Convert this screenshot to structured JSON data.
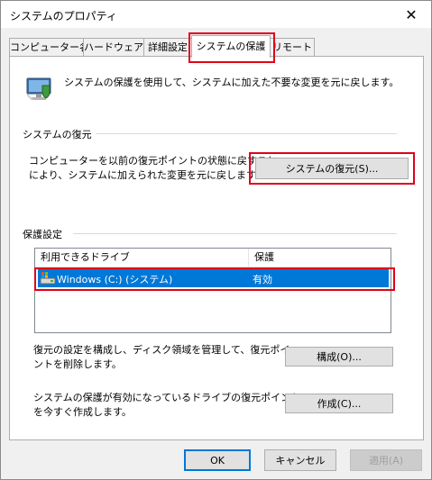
{
  "window": {
    "title": "システムのプロパティ",
    "close_glyph": "✕"
  },
  "tabs": [
    {
      "label": "コンピューター名",
      "active": false
    },
    {
      "label": "ハードウェア",
      "active": false
    },
    {
      "label": "詳細設定",
      "active": false
    },
    {
      "label": "システムの保護",
      "active": true
    },
    {
      "label": "リモート",
      "active": false
    }
  ],
  "intro": {
    "icon": "system-protection-icon",
    "text": "システムの保護を使用して、システムに加えた不要な変更を元に戻します。"
  },
  "restore": {
    "group_title": "システムの復元",
    "description_line1": "コンピューターを以前の復元ポイントの状態に戻すこと",
    "description_line2": "により、システムに加えられた変更を元に戻します。",
    "button_label": "システムの復元(S)..."
  },
  "protection": {
    "group_title": "保護設定",
    "columns": [
      "利用できるドライブ",
      "保護"
    ],
    "rows": [
      {
        "drive": "Windows (C:) (システム)",
        "status": "有効",
        "icon": "drive-icon",
        "selected": true
      }
    ],
    "configure_description_line1": "復元の設定を構成し、ディスク領域を管理して、復元ポイ",
    "configure_description_line2": "ントを削除します。",
    "configure_button_label": "構成(O)...",
    "create_description_line1": "システムの保護が有効になっているドライブの復元ポイント",
    "create_description_line2": "を今すぐ作成します。",
    "create_button_label": "作成(C)..."
  },
  "footer": {
    "ok_label": "OK",
    "cancel_label": "キャンセル",
    "apply_label": "適用(A)"
  },
  "highlight_color": "#e0001a",
  "selection_color": "#0078d7"
}
